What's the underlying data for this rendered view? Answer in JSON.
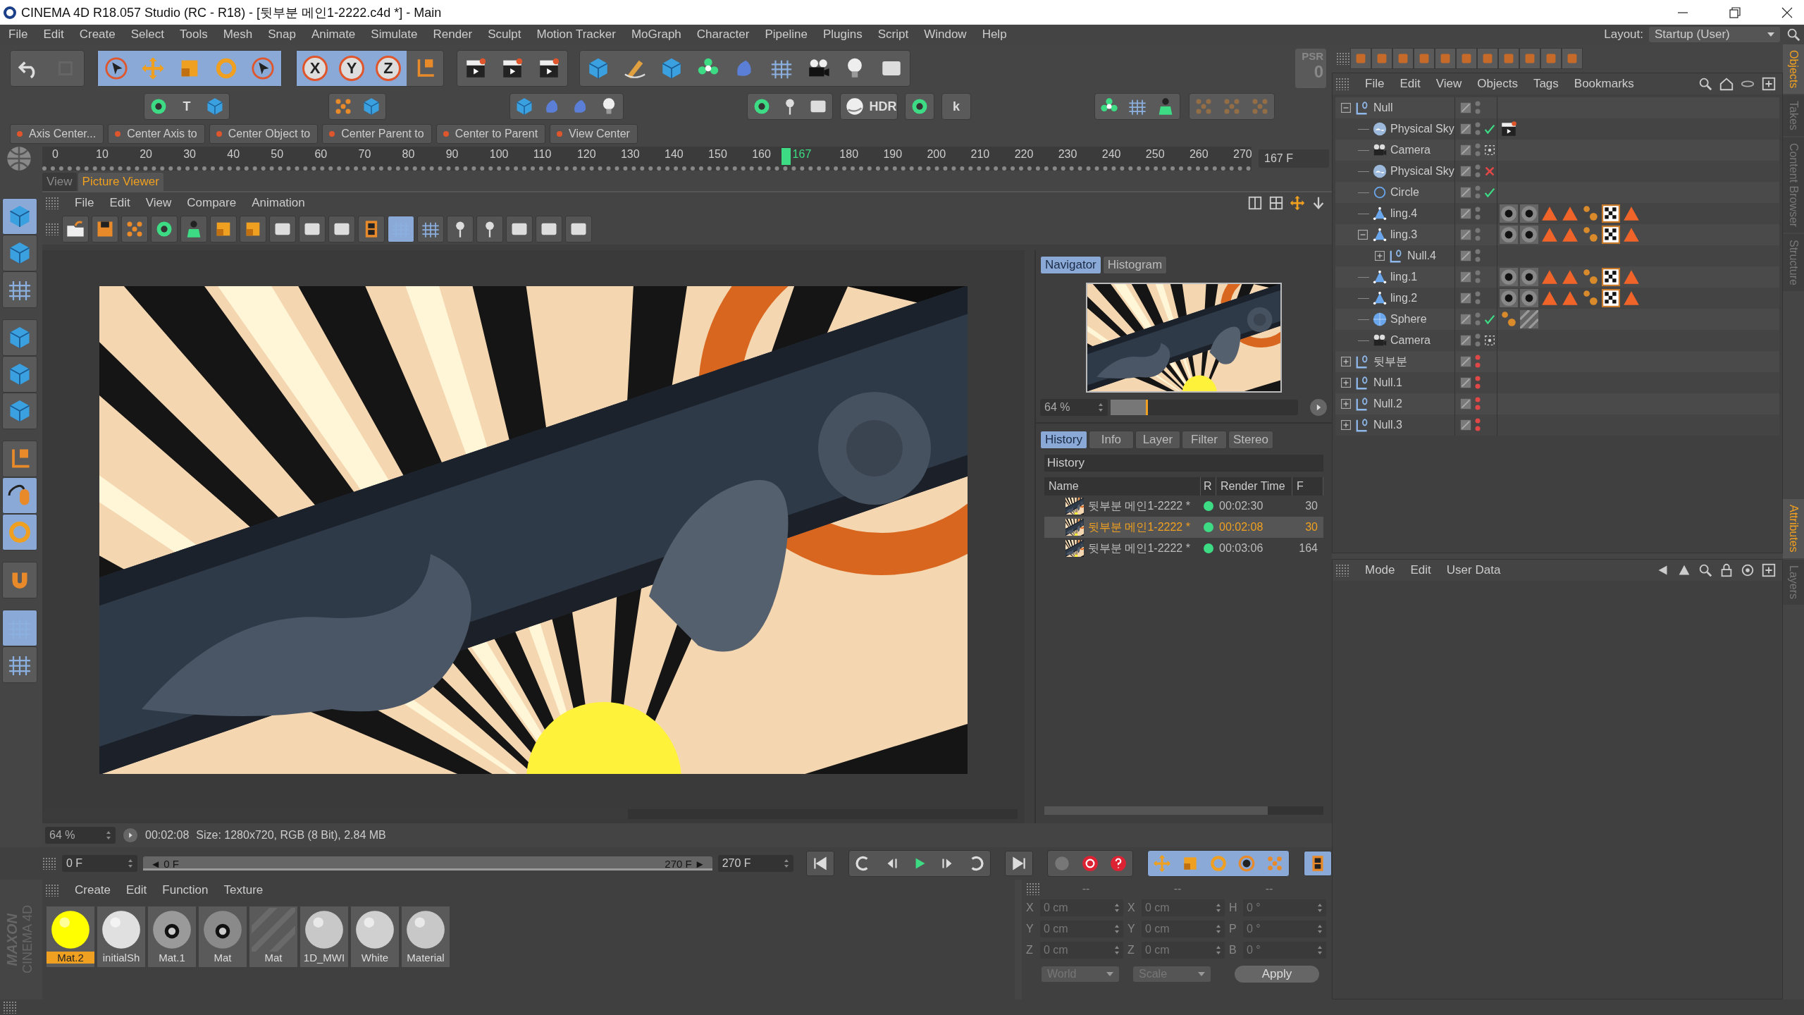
{
  "window": {
    "title": "CINEMA 4D R18.057 Studio (RC - R18) - [뒷부분 메인1-2222.c4d *] - Main"
  },
  "menu": [
    "File",
    "Edit",
    "Create",
    "Select",
    "Tools",
    "Mesh",
    "Snap",
    "Animate",
    "Simulate",
    "Render",
    "Sculpt",
    "Motion Tracker",
    "MoGraph",
    "Character",
    "Pipeline",
    "Plugins",
    "Script",
    "Window",
    "Help"
  ],
  "layout": {
    "label": "Layout:",
    "value": "Startup (User)"
  },
  "toolbar": {
    "rows": [
      [
        [
          {
            "selected": false
          },
          {
            "selected": false,
            "disabled": true
          }
        ],
        [
          {
            "selected": true
          },
          {
            "selected": true
          },
          {
            "selected": true
          },
          {
            "selected": true
          },
          {
            "selected": true
          }
        ],
        [
          {
            "label": "X",
            "selected": true
          },
          {
            "label": "Y",
            "selected": true
          },
          {
            "label": "Z",
            "selected": true
          },
          {
            "selected": false
          }
        ],
        [
          {
            "selected": false
          },
          {
            "selected": false
          },
          {
            "selected": false
          }
        ],
        [
          {
            "selected": false
          },
          {
            "selected": false
          },
          {
            "selected": false
          },
          {
            "selected": false
          },
          {
            "selected": false
          },
          {
            "selected": false
          },
          {
            "selected": false
          },
          {
            "selected": false
          },
          {
            "selected": false
          }
        ]
      ],
      [
        [
          {
            "selected": false
          },
          {
            "label": "T",
            "selected": false
          },
          {
            "selected": false
          }
        ],
        [
          {
            "selected": false
          },
          {
            "selected": false
          }
        ],
        [
          {
            "selected": false
          },
          {
            "selected": false
          },
          {
            "selected": false
          },
          {
            "selected": false
          }
        ],
        [
          {
            "selected": false
          },
          {
            "selected": false
          },
          {
            "selected": false
          }
        ],
        [
          {
            "selected": false
          },
          {
            "label": "HDR",
            "selected": false
          }
        ],
        [
          {
            "selected": false
          }
        ],
        [
          {
            "label": "k",
            "selected": false
          }
        ],
        [
          {
            "selected": false
          },
          {
            "selected": false
          },
          {
            "selected": false
          }
        ],
        [
          {
            "selected": false,
            "disabled": true
          },
          {
            "selected": false,
            "disabled": true
          },
          {
            "selected": false,
            "disabled": true
          }
        ]
      ]
    ]
  },
  "psr": {
    "label": "PSR",
    "value": "0"
  },
  "commands": [
    "Axis Center...",
    "Center Axis to",
    "Center Object to",
    "Center Parent to",
    "Center to Parent",
    "View Center"
  ],
  "ruler": {
    "ticks": [
      "0",
      "10",
      "20",
      "30",
      "40",
      "50",
      "60",
      "70",
      "80",
      "90",
      "100",
      "110",
      "120",
      "130",
      "140",
      "150",
      "160",
      "180",
      "190",
      "200",
      "210",
      "220",
      "230",
      "240",
      "250",
      "260",
      "270"
    ],
    "current": "167",
    "level": 0.6185
  },
  "frame_field": "167 F",
  "left_tools": [
    {
      "selected": true
    },
    {
      "selected": false
    },
    {
      "selected": false
    },
    {
      "selected": false
    },
    {
      "selected": false
    },
    {
      "selected": false
    },
    {
      "selected": false
    },
    {
      "selected": true
    },
    {
      "selected": true
    },
    {
      "selected": false
    },
    {
      "selected": true
    },
    {
      "selected": false
    }
  ],
  "viewer": {
    "tabs": [
      {
        "label": "View",
        "selected": false
      },
      {
        "label": "Picture Viewer",
        "selected": true
      }
    ],
    "menu": [
      "File",
      "Edit",
      "View",
      "Compare",
      "Animation"
    ],
    "toolbar": [
      {
        "selected": false
      },
      {
        "selected": false
      },
      {
        "selected": false
      },
      {
        "selected": false
      },
      {
        "selected": false
      },
      {
        "selected": false
      },
      {
        "selected": false
      },
      {
        "selected": false
      },
      {
        "selected": false
      },
      {
        "selected": false
      },
      {
        "selected": false
      },
      {
        "selected": true
      },
      {
        "selected": false
      },
      {
        "selected": false
      },
      {
        "selected": false
      },
      {
        "selected": false
      },
      {
        "selected": false
      },
      {
        "selected": false
      }
    ],
    "image": {
      "kind": "picture"
    },
    "navigator": {
      "tabs": [
        {
          "label": "Navigator",
          "selected": true
        },
        {
          "label": "Histogram",
          "selected": false
        }
      ],
      "zoom": "64 %",
      "level": 0.2
    },
    "history": {
      "tabs": [
        {
          "label": "History",
          "selected": true
        },
        {
          "label": "Info",
          "selected": false
        },
        {
          "label": "Layer",
          "selected": false
        },
        {
          "label": "Filter",
          "selected": false
        },
        {
          "label": "Stereo",
          "selected": false
        }
      ],
      "title": "History",
      "columns": [
        "Name",
        "R",
        "Render Time",
        "F"
      ],
      "rows": [
        {
          "name": "뒷부분 메인1-2222 *",
          "time": "00:02:30",
          "frames": "30",
          "selected": false
        },
        {
          "name": "뒷부분 메인1-2222 *",
          "time": "00:02:08",
          "frames": "30",
          "selected": true
        },
        {
          "name": "뒷부분 메인1-2222 *",
          "time": "00:03:06",
          "frames": "164",
          "selected": false
        }
      ]
    },
    "status": {
      "zoom": "64 %",
      "time": "00:02:08",
      "info": "Size: 1280x720, RGB (8 Bit), 2.84 MB"
    }
  },
  "timeline": {
    "start": "0 F",
    "range_start": "◄ 0 F",
    "range_end": "270 F ►",
    "level": 1,
    "end": "270 F"
  },
  "materials": {
    "menu": [
      "Create",
      "Edit",
      "Function",
      "Texture"
    ],
    "items": [
      {
        "name": "Mat.2",
        "kind": "plain",
        "color": "#ffff00",
        "selected": true
      },
      {
        "name": "initialSh",
        "kind": "plain",
        "color": "#e0e0e0",
        "selected": false
      },
      {
        "name": "Mat.1",
        "kind": "metal",
        "color": "#9a9a9a",
        "selected": false
      },
      {
        "name": "Mat",
        "kind": "metal",
        "color": "#8a8a8a",
        "selected": false
      },
      {
        "name": "Mat",
        "kind": "empty",
        "color": "#6a6a6a",
        "selected": false
      },
      {
        "name": "1D_MWI",
        "kind": "plain",
        "color": "#c8c8c8",
        "selected": false
      },
      {
        "name": "White",
        "kind": "plain",
        "color": "#d0d0d0",
        "selected": false
      },
      {
        "name": "Material",
        "kind": "plain",
        "color": "#c8c8c8",
        "selected": false
      }
    ]
  },
  "coordinates": {
    "headers": [
      "--",
      "--",
      "--"
    ],
    "rows": [
      [
        {
          "axis": "X",
          "value": "0 cm"
        },
        {
          "axis": "X",
          "value": "0 cm"
        },
        {
          "axis": "H",
          "value": "0 °"
        }
      ],
      [
        {
          "axis": "Y",
          "value": "0 cm"
        },
        {
          "axis": "Y",
          "value": "0 cm"
        },
        {
          "axis": "P",
          "value": "0 °"
        }
      ],
      [
        {
          "axis": "Z",
          "value": "0 cm"
        },
        {
          "axis": "Z",
          "value": "0 cm"
        },
        {
          "axis": "B",
          "value": "0 °"
        }
      ]
    ],
    "dropdowns": [
      "World",
      "Scale"
    ],
    "apply": "Apply"
  },
  "logo": {
    "brand": "MAXON",
    "product": "CINEMA 4D"
  },
  "objects": {
    "menu": [
      "File",
      "Edit",
      "View",
      "Objects",
      "Tags",
      "Bookmarks"
    ],
    "tree": [
      {
        "name": "Null",
        "kind": "null",
        "expanded": true,
        "hidden": false,
        "children": [
          {
            "name": "Physical Sky",
            "kind": "sky",
            "hidden": false,
            "status": {
              "kind": "check"
            },
            "tags": [
              {
                "kind": "render"
              }
            ]
          },
          {
            "name": "Camera",
            "kind": "camera",
            "hidden": false,
            "status": {
              "kind": "target"
            }
          },
          {
            "name": "Physical Sky",
            "kind": "sky",
            "hidden": false,
            "status": {
              "kind": "cross"
            }
          },
          {
            "name": "Circle",
            "kind": "circle",
            "hidden": false,
            "status": {
              "kind": "check"
            }
          },
          {
            "name": "ling.4",
            "kind": "poly",
            "hidden": false,
            "tags": [
              {
                "kind": "material"
              },
              {
                "kind": "material"
              },
              {
                "kind": "triangle"
              },
              {
                "kind": "triangle"
              },
              {
                "kind": "dots"
              },
              {
                "kind": "checker"
              },
              {
                "kind": "triangle"
              }
            ]
          },
          {
            "name": "ling.3",
            "kind": "poly",
            "expanded": true,
            "hidden": false,
            "tags": [
              {
                "kind": "material"
              },
              {
                "kind": "material"
              },
              {
                "kind": "triangle"
              },
              {
                "kind": "triangle"
              },
              {
                "kind": "dots"
              },
              {
                "kind": "checker"
              },
              {
                "kind": "triangle"
              }
            ],
            "children": [
              {
                "name": "Null.4",
                "kind": "null",
                "expanded": false,
                "hidden": false
              }
            ]
          },
          {
            "name": "ling.1",
            "kind": "poly",
            "hidden": false,
            "tags": [
              {
                "kind": "material"
              },
              {
                "kind": "material"
              },
              {
                "kind": "triangle"
              },
              {
                "kind": "triangle"
              },
              {
                "kind": "dots"
              },
              {
                "kind": "checker"
              },
              {
                "kind": "triangle"
              }
            ]
          },
          {
            "name": "ling.2",
            "kind": "poly",
            "hidden": false,
            "tags": [
              {
                "kind": "material"
              },
              {
                "kind": "material"
              },
              {
                "kind": "triangle"
              },
              {
                "kind": "triangle"
              },
              {
                "kind": "dots"
              },
              {
                "kind": "checker"
              },
              {
                "kind": "triangle"
              }
            ]
          },
          {
            "name": "Sphere",
            "kind": "sphere",
            "hidden": false,
            "status": {
              "kind": "check"
            },
            "tags": [
              {
                "kind": "dots"
              },
              {
                "kind": "stripes"
              }
            ]
          },
          {
            "name": "Camera",
            "kind": "camera",
            "hidden": false,
            "status": {
              "kind": "target"
            }
          }
        ]
      },
      {
        "name": "뒷부분",
        "kind": "null",
        "expanded": false,
        "hidden": true
      },
      {
        "name": "Null.1",
        "kind": "null",
        "expanded": false,
        "hidden": true
      },
      {
        "name": "Null.2",
        "kind": "null",
        "expanded": false,
        "hidden": true
      },
      {
        "name": "Null.3",
        "kind": "null",
        "expanded": false,
        "hidden": true
      }
    ]
  },
  "attributes": {
    "menu": [
      "Mode",
      "Edit",
      "User Data"
    ]
  },
  "side_tabs": {
    "upper": [
      {
        "label": "Objects",
        "selected": true
      },
      {
        "label": "Takes",
        "selected": false
      },
      {
        "label": "Content Browser",
        "selected": false
      },
      {
        "label": "Structure",
        "selected": false
      }
    ],
    "lower": [
      {
        "label": "Attributes",
        "selected": true
      },
      {
        "label": "Layers",
        "selected": false
      }
    ]
  }
}
